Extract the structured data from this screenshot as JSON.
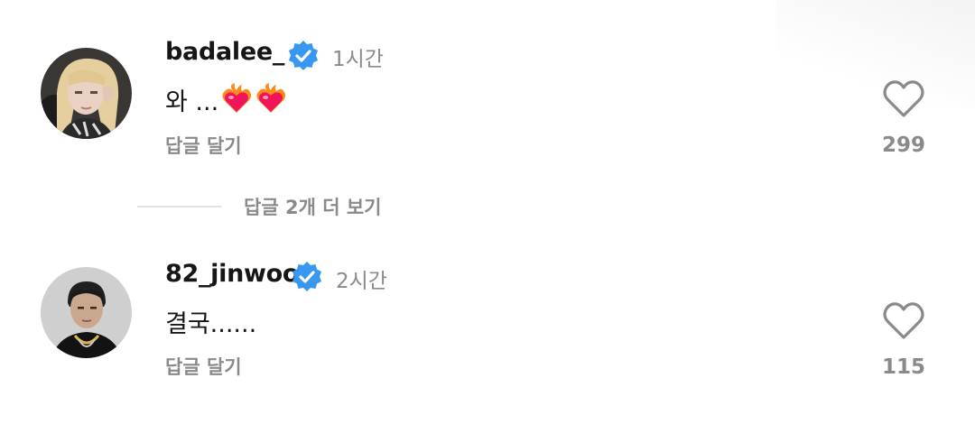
{
  "comments": [
    {
      "username": "badalee_",
      "time": "1시간",
      "text": "와 ...",
      "emoji": [
        "heart-on-fire-emoji",
        "heart-on-fire-emoji"
      ],
      "reply_label": "답글 달기",
      "likes": "299",
      "avatar": "woman-with-blonde-hair"
    },
    {
      "username": "82_jinwoo",
      "time": "2시간",
      "text": "결국......",
      "reply_label": "답글 달기",
      "likes": "115",
      "avatar": "man-in-dark-outfit"
    }
  ],
  "view_more_replies": "답글 2개 더 보기",
  "colors": {
    "verified": "#3897f0",
    "secondary_text": "#8a8a8a",
    "primary_text": "#161616"
  }
}
